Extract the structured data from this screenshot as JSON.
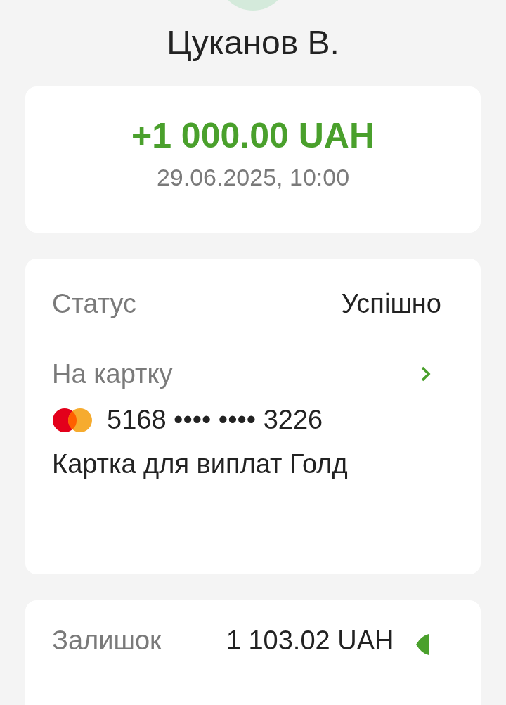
{
  "recipient": {
    "name": "Цуканов В."
  },
  "transfer": {
    "amount": "+1 000.00 UAH",
    "datetime": "29.06.2025, 10:00"
  },
  "details": {
    "status_label": "Статус",
    "status_value": "Успішно",
    "destination_label": "На картку",
    "card_number": "5168 •••• •••• 3226",
    "card_name": "Картка для виплат Голд"
  },
  "balance": {
    "label": "Залишок",
    "value": "1 103.02 UAH"
  }
}
